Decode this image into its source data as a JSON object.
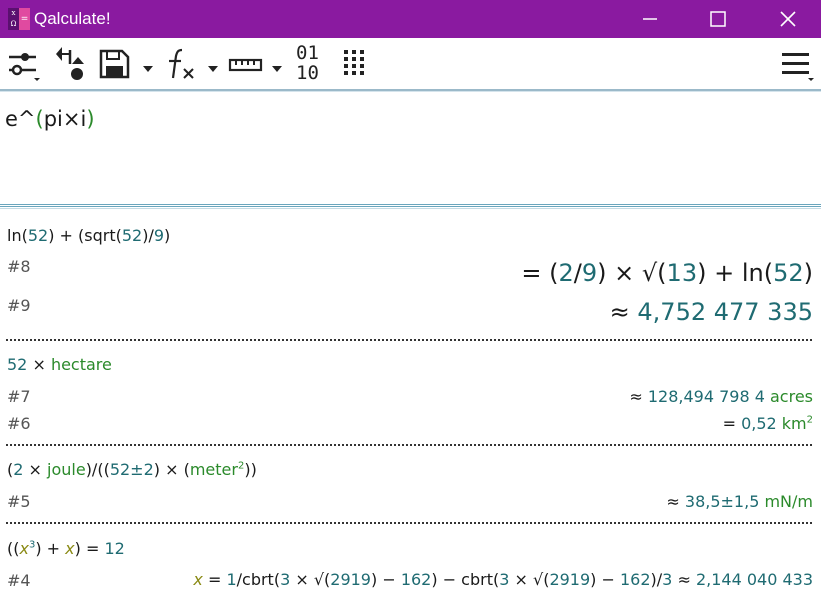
{
  "window": {
    "title": "Qalculate!",
    "icon_left_top": "x",
    "icon_left_bottom": "Ω",
    "icon_right": "="
  },
  "toolbar": {
    "binary_top": "01",
    "binary_bottom": "10",
    "icons": [
      "settings-sliders-icon",
      "stack-icon",
      "save-icon",
      "function-icon",
      "ruler-icon",
      "binary-icon",
      "keypad-icon",
      "menu-icon"
    ]
  },
  "input": {
    "expression_parts": [
      "e^",
      "(",
      "pi×i",
      ")"
    ]
  },
  "history": [
    {
      "expression": {
        "p1": "ln(",
        "n1": "52",
        "p2": ") + (sqrt(",
        "n2": "52",
        "p3": ")∕",
        "n3": "9",
        "p4": ")"
      },
      "results": [
        {
          "id": "#8",
          "parts": {
            "a": "= (",
            "b": "2",
            "c": "∕",
            "d": "9",
            "e": ") × √(",
            "f": "13",
            "g": ") + ln(",
            "h": "52",
            "i": ")"
          }
        },
        {
          "id": "#9",
          "parts": {
            "a": "≈ ",
            "b": "4,752 477 335"
          }
        }
      ]
    },
    {
      "expression": {
        "n1": "52",
        "op": " × ",
        "unit": "hectare"
      },
      "results": [
        {
          "id": "#7",
          "parts": {
            "a": "≈ ",
            "b": "128,494 798 4",
            "c": " acres"
          }
        },
        {
          "id": "#6",
          "parts": {
            "a": "= ",
            "b": "0,52",
            "c": " km",
            "sup": "2"
          }
        }
      ]
    },
    {
      "expression": {
        "p1": "(",
        "n1": "2",
        "p2": " × ",
        "u1": "joule",
        "p3": ")∕((",
        "n2": "52±2",
        "p4": ") × (",
        "u2": "meter",
        "sup": "2",
        "p5": "))"
      },
      "results": [
        {
          "id": "#5",
          "parts": {
            "a": "≈ ",
            "b": "38,5±1,5",
            "c": " mN∕m"
          }
        }
      ]
    },
    {
      "expression": {
        "p1": "((",
        "v1": "x",
        "sup": "3",
        "p2": ") + ",
        "v2": "x",
        "p3": ") = ",
        "n1": "12"
      },
      "results": [
        {
          "id": "#4",
          "parts": {
            "v": "x",
            "a": " = ",
            "n1": "1",
            "b": "∕cbrt(",
            "n2": "3",
            "c": " × √(",
            "n3": "2919",
            "d": ") − ",
            "n4": "162",
            "e": ") − cbrt(",
            "n5": "3",
            "f": " × √(",
            "n6": "2919",
            "g": ") − ",
            "n7": "162",
            "h": ")∕",
            "n8": "3",
            "i": " ≈ ",
            "n9": "2,144 040 433"
          }
        }
      ]
    }
  ]
}
